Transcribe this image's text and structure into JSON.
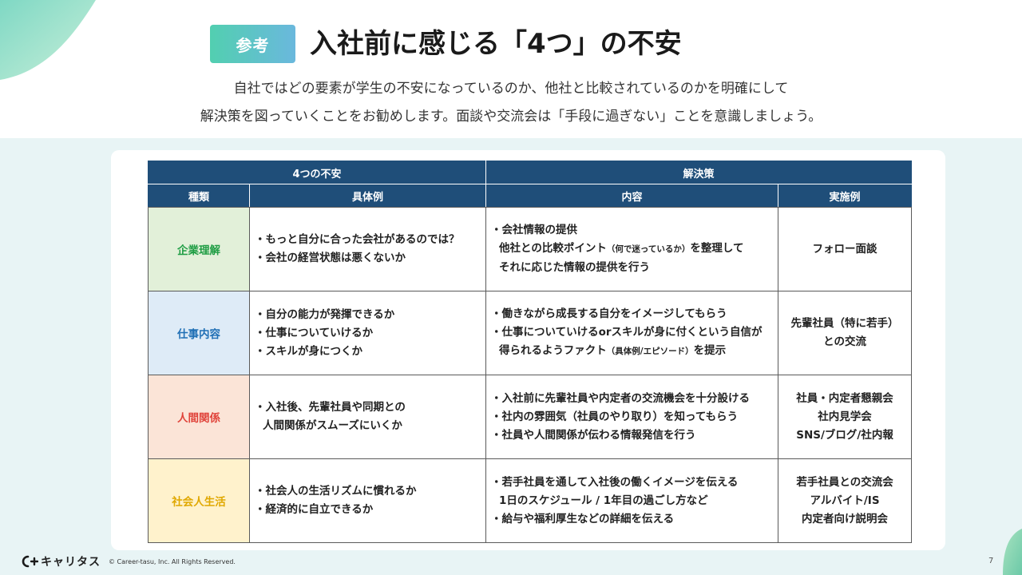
{
  "header": {
    "badge": "参考",
    "title": "入社前に感じる「4つ」の不安",
    "subtitle_line1": "自社ではどの要素が学生の不安になっているのか、他社と比較されているのかを明確にして",
    "subtitle_line2": "解決策を図っていくことをお勧めします。面談や交流会は「手段に過ぎない」ことを意識しましょう。"
  },
  "table": {
    "group_headers": [
      "4つの不安",
      "解決策"
    ],
    "col_headers": [
      "種類",
      "具体例",
      "内容",
      "実施例"
    ],
    "rows": [
      {
        "type": "企業理解",
        "examples": [
          "・もっと自分に合った会社があるのでは？",
          "・会社の経営状態は悪くないか"
        ],
        "content": {
          "l1": "・会社情報の提供",
          "l2a": "他社との比較ポイント",
          "l2small": "（何で迷っているか）",
          "l2b": "を整理して",
          "l3": "それに応じた情報の提供を行う"
        },
        "cases": [
          "フォロー面談"
        ]
      },
      {
        "type": "仕事内容",
        "examples": [
          "・自分の能力が発揮できるか",
          "・仕事についていけるか",
          "・スキルが身につくか"
        ],
        "content": {
          "l1": "・働きながら成長する自分をイメージしてもらう",
          "l2": "・仕事についていけるorスキルが身に付くという自信が",
          "l3a": "得られるようファクト",
          "l3small": "（具体例/エピソード）",
          "l3b": "を提示"
        },
        "cases": [
          "先輩社員（特に若手）",
          "との交流"
        ]
      },
      {
        "type": "人間関係",
        "examples": [
          "・入社後、先輩社員や同期との",
          "人間関係がスムーズにいくか"
        ],
        "content": {
          "l1": "・入社前に先輩社員や内定者の交流機会を十分設ける",
          "l2": "・社内の雰囲気（社員のやり取り）を知ってもらう",
          "l3": "・社員や人間関係が伝わる情報発信を行う"
        },
        "cases": [
          "社員・内定者懇親会",
          "社内見学会",
          "SNS/ブログ/社内報"
        ]
      },
      {
        "type": "社会人生活",
        "examples": [
          "・社会人の生活リズムに慣れるか",
          "・経済的に自立できるか"
        ],
        "content": {
          "l1": "・若手社員を通して入社後の働くイメージを伝える",
          "l2": "1日のスケジュール / 1年目の過ごし方など",
          "l3": "・給与や福利厚生などの詳細を伝える"
        },
        "cases": [
          "若手社員との交流会",
          "アルバイト/IS",
          "内定者向け説明会"
        ]
      }
    ]
  },
  "footer": {
    "logo_text": "キャリタス",
    "copyright": "© Career-tasu, Inc. All Rights Reserved.",
    "page_number": "7"
  },
  "colors": {
    "header_bg": "#1f4e79",
    "type_green": "#1f9d44",
    "type_blue": "#1f6fb5",
    "type_red": "#e0433a",
    "type_yellow": "#e0a800"
  }
}
